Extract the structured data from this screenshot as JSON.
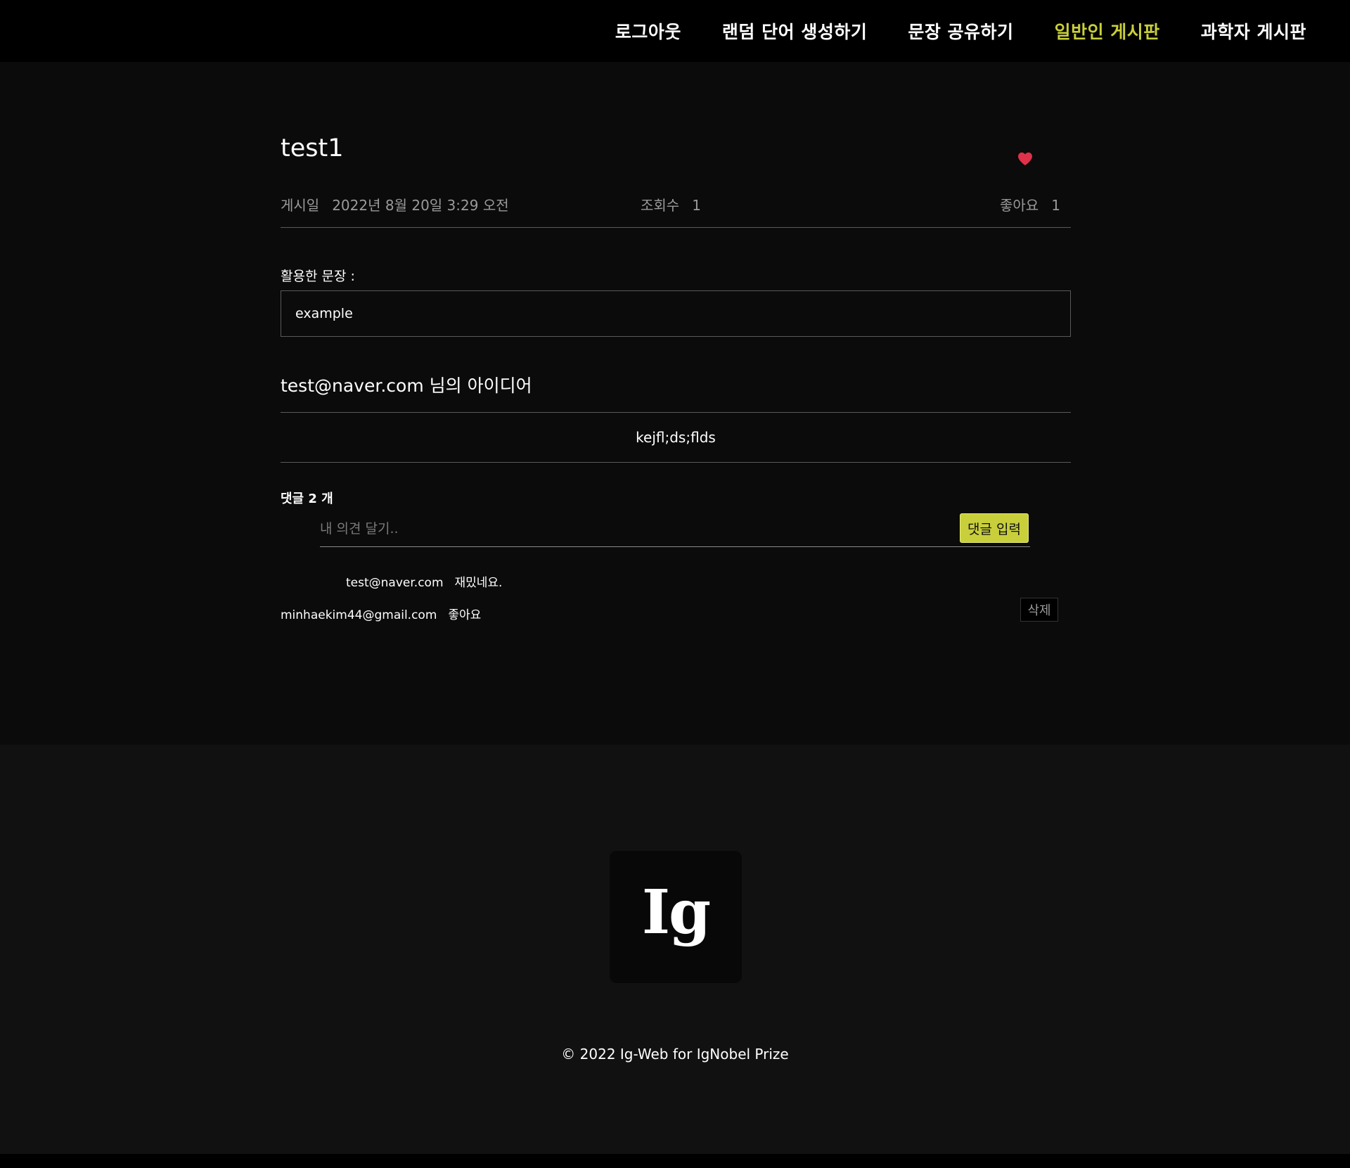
{
  "nav": {
    "items": [
      {
        "label": "로그아웃"
      },
      {
        "label": "랜덤 단어 생성하기"
      },
      {
        "label": "문장 공유하기"
      },
      {
        "label": "일반인 게시판"
      },
      {
        "label": "과학자 게시판"
      }
    ],
    "active_color": "#c9cf3b"
  },
  "post": {
    "title": "test1",
    "liked_icon": "heart-icon",
    "heart_color": "#e0314b",
    "meta": {
      "date_label": "게시일",
      "date_value": "2022년 8월 20일 3:29 오전",
      "views_label": "조회수",
      "views_value": "1",
      "likes_label": "좋아요",
      "likes_value": "1"
    },
    "sentence_label": "활용한 문장 :",
    "sentence_value": "example",
    "idea_title": "test@naver.com 님의 아이디어",
    "idea_body": "kejfl;ds;flds"
  },
  "comments": {
    "count_label": "댓글 2 개",
    "input_placeholder": "내 의견 달기..",
    "submit_label": "댓글 입력",
    "delete_label": "삭제",
    "items": [
      {
        "author": "test@naver.com",
        "text": "재밌네요."
      },
      {
        "author": "minhaekim44@gmail.com",
        "text": "좋아요"
      }
    ]
  },
  "footer": {
    "logo_text": "Ig",
    "copyright": "© 2022 Ig-Web for IgNobel Prize"
  }
}
